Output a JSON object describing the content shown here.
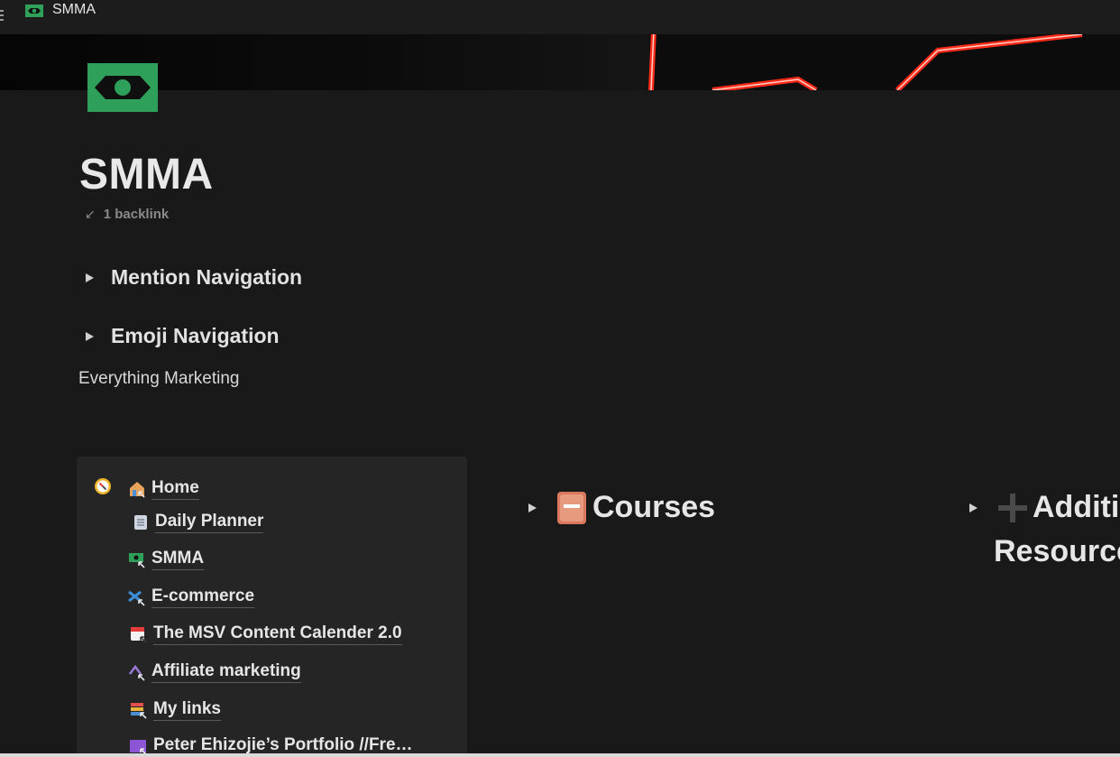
{
  "topbar": {
    "title": "SMMA",
    "icon": "money-icon"
  },
  "page": {
    "title": "SMMA",
    "backlinks": "1 backlink",
    "toggles": [
      "Mention Navigation",
      "Emoji Navigation"
    ],
    "paragraph": "Everything Marketing"
  },
  "nav": {
    "items": [
      {
        "label": "Home",
        "icon": "home-link-icon"
      },
      {
        "label": "Daily Planner",
        "icon": "notepad-icon"
      },
      {
        "label": "SMMA",
        "icon": "money-link-icon"
      },
      {
        "label": "E-commerce",
        "icon": "ecommerce-link-icon"
      },
      {
        "label": "The MSV Content Calender 2.0",
        "icon": "calendar-link-icon"
      },
      {
        "label": "Affiliate marketing",
        "icon": "affiliate-link-icon"
      },
      {
        "label": "My links",
        "icon": "links-icon"
      },
      {
        "label": "Peter Ehizojie’s Portfolio //Fre…",
        "icon": "portfolio-icon"
      }
    ]
  },
  "sections": {
    "courses": "Courses",
    "additional_line1": "Additi",
    "additional_line2": "Resource"
  },
  "colors": {
    "background": "#191919",
    "panel": "#252525",
    "accent_green": "#2ea05a",
    "neon_red": "#ff2a1a"
  }
}
